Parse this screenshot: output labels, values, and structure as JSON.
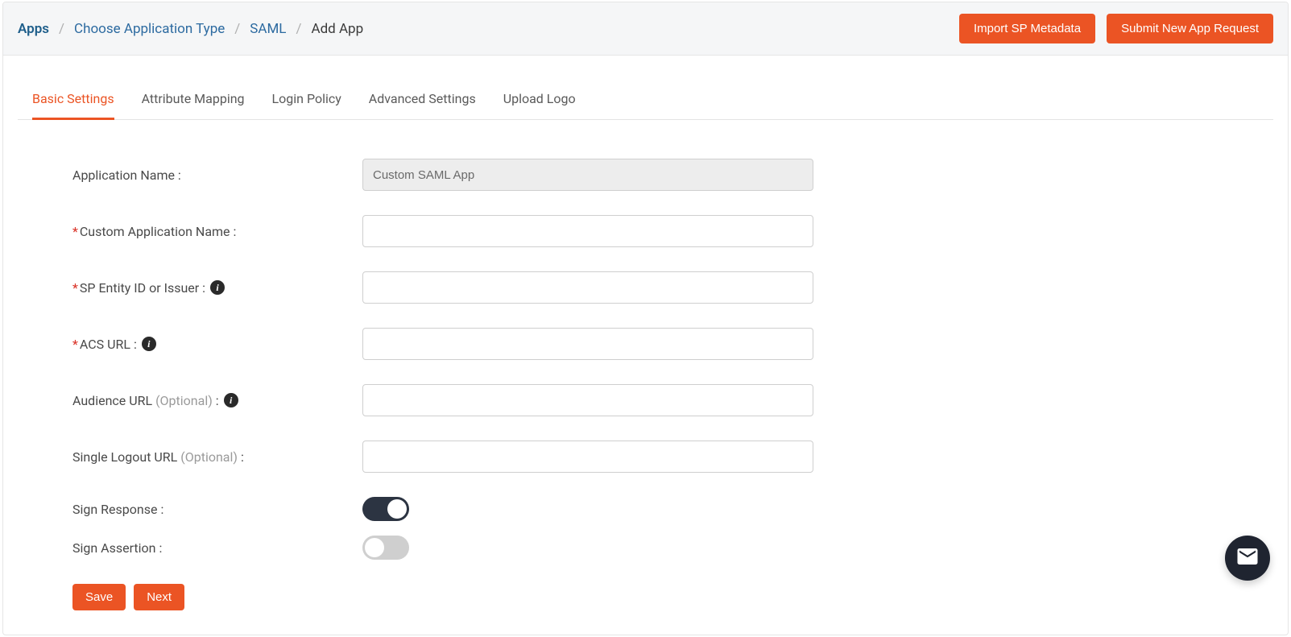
{
  "breadcrumb": {
    "apps": "Apps",
    "choose_type": "Choose Application Type",
    "saml": "SAML",
    "current": "Add App"
  },
  "header_actions": {
    "import_metadata": "Import SP Metadata",
    "submit_request": "Submit New App Request"
  },
  "tabs": [
    {
      "id": "basic",
      "label": "Basic Settings",
      "active": true
    },
    {
      "id": "attr",
      "label": "Attribute Mapping",
      "active": false
    },
    {
      "id": "login",
      "label": "Login Policy",
      "active": false
    },
    {
      "id": "adv",
      "label": "Advanced Settings",
      "active": false
    },
    {
      "id": "logo",
      "label": "Upload Logo",
      "active": false
    }
  ],
  "form": {
    "app_name": {
      "label": "Application Name :",
      "value": "Custom SAML App"
    },
    "custom_name": {
      "label": "Custom Application Name :",
      "value": "",
      "required": true
    },
    "sp_entity": {
      "label": "SP Entity ID or Issuer :",
      "value": "",
      "required": true,
      "info": true
    },
    "acs_url": {
      "label": "ACS URL :",
      "value": "",
      "required": true,
      "info": true
    },
    "audience": {
      "label_main": "Audience URL ",
      "optional": "(Optional)",
      "colon": " :",
      "value": "",
      "info": true
    },
    "slo": {
      "label_main": "Single Logout URL ",
      "optional": "(Optional)",
      "colon": " :",
      "value": ""
    },
    "sign_response": {
      "label": "Sign Response :",
      "on": true
    },
    "sign_assertion": {
      "label": "Sign Assertion :",
      "on": false
    }
  },
  "actions": {
    "save": "Save",
    "next": "Next"
  }
}
